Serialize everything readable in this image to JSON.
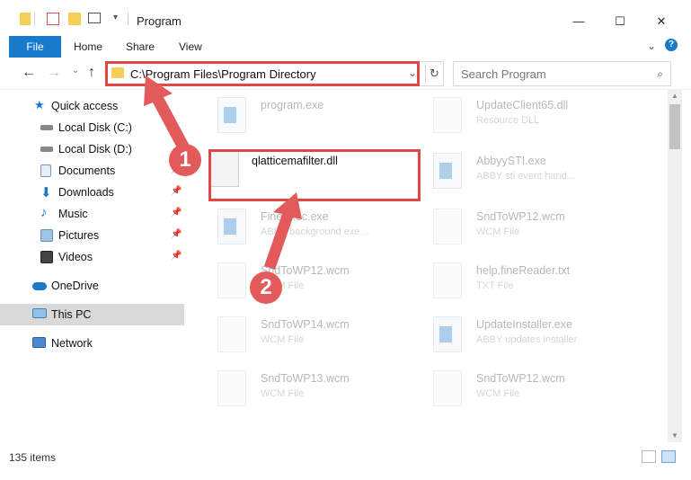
{
  "window": {
    "title": "Program",
    "minimize": "—",
    "maximize": "☐",
    "close": "✕"
  },
  "ribbon": {
    "tabs": [
      "File",
      "Home",
      "Share",
      "View"
    ],
    "expand": "⌄",
    "help": "?"
  },
  "nav": {
    "back": "←",
    "forward": "→",
    "recent": "⌄",
    "up": "↑",
    "address": "C:\\Program Files\\Program Directory",
    "refresh": "↻",
    "search_placeholder": "Search Program"
  },
  "sidebar": {
    "items": [
      {
        "label": "Quick access",
        "icon": "star-icon",
        "pinned": false
      },
      {
        "label": "Local Disk (C:)",
        "icon": "drive-icon",
        "pinned": true
      },
      {
        "label": "Local Disk (D:)",
        "icon": "drive-icon",
        "pinned": false
      },
      {
        "label": "Documents",
        "icon": "documents-icon",
        "pinned": true
      },
      {
        "label": "Downloads",
        "icon": "downloads-icon",
        "pinned": true
      },
      {
        "label": "Music",
        "icon": "music-icon",
        "pinned": true
      },
      {
        "label": "Pictures",
        "icon": "pictures-icon",
        "pinned": true
      },
      {
        "label": "Videos",
        "icon": "videos-icon",
        "pinned": true
      },
      {
        "label": "OneDrive",
        "icon": "cloud-icon",
        "pinned": false
      },
      {
        "label": "This PC",
        "icon": "computer-icon",
        "pinned": false,
        "selected": true
      },
      {
        "label": "Network",
        "icon": "network-icon",
        "pinned": false
      }
    ]
  },
  "files": [
    {
      "name": "program.exe",
      "type": "",
      "kind": "exe"
    },
    {
      "name": "UpdateClient65.dll",
      "type": "Resource DLL",
      "kind": "dll"
    },
    {
      "name": "qlatticemafilter.dll",
      "type": "",
      "kind": "dll",
      "focus": true
    },
    {
      "name": "AbbyySTI.exe",
      "type": "ABBY sti event hand...",
      "kind": "exe"
    },
    {
      "name": "FineExec.exe",
      "type": "ABBY background exe...",
      "kind": "exe"
    },
    {
      "name": "SndToWP12.wcm",
      "type": "WCM File",
      "kind": "file"
    },
    {
      "name": "SndToWP12.wcm",
      "type": "WCM File",
      "kind": "file"
    },
    {
      "name": "help.fineReader.txt",
      "type": "TXT File",
      "kind": "file"
    },
    {
      "name": "SndToWP14.wcm",
      "type": "WCM File",
      "kind": "file"
    },
    {
      "name": "UpdateInstaller.exe",
      "type": "ABBY updates installer",
      "kind": "exe"
    },
    {
      "name": "SndToWP13.wcm",
      "type": "WCM File",
      "kind": "file"
    },
    {
      "name": "SndToWP12.wcm",
      "type": "WCM File",
      "kind": "file"
    }
  ],
  "status": {
    "count": "135 items"
  },
  "annotations": {
    "badge1": "1",
    "badge2": "2",
    "color": "#e25a5a"
  }
}
